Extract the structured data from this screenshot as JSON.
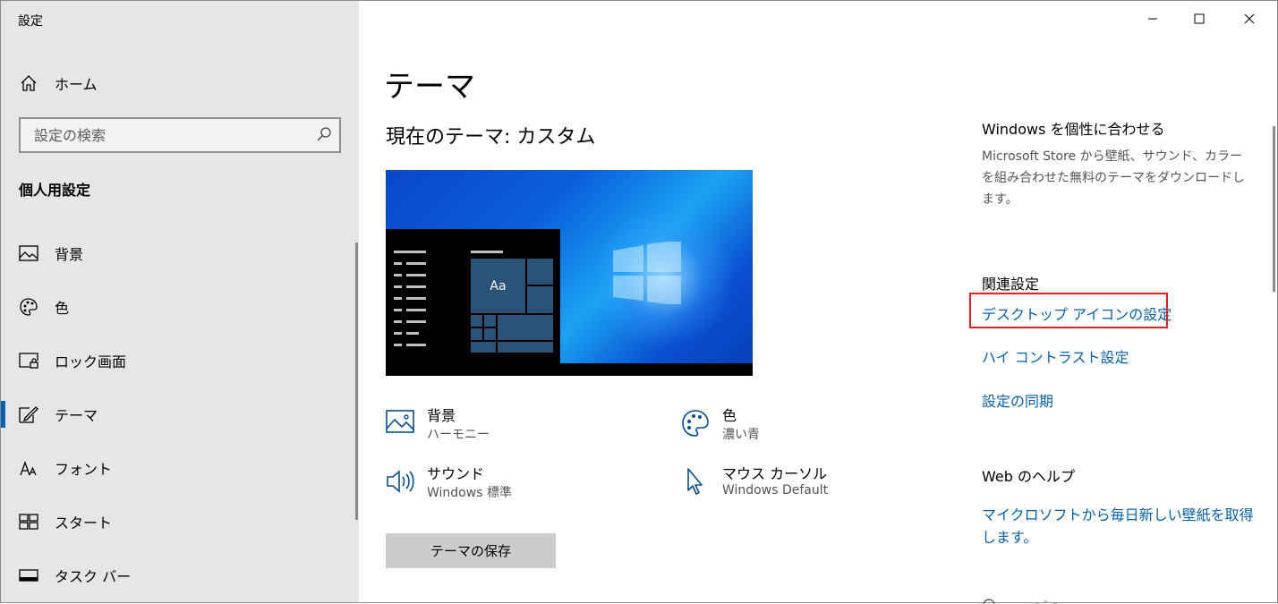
{
  "app": {
    "title": "設定"
  },
  "sidebar": {
    "home_label": "ホーム",
    "search_placeholder": "設定の検索",
    "section_title": "個人用設定",
    "items": [
      {
        "label": "背景",
        "icon": "image-icon"
      },
      {
        "label": "色",
        "icon": "palette-icon"
      },
      {
        "label": "ロック画面",
        "icon": "lock-screen-icon"
      },
      {
        "label": "テーマ",
        "icon": "theme-brush-icon",
        "active": true
      },
      {
        "label": "フォント",
        "icon": "font-icon"
      },
      {
        "label": "スタート",
        "icon": "start-grid-icon"
      },
      {
        "label": "タスク バー",
        "icon": "taskbar-icon"
      }
    ]
  },
  "main": {
    "title": "テーマ",
    "current_theme": "現在のテーマ: カスタム",
    "preview_tile_label": "Aa",
    "properties": [
      {
        "title": "背景",
        "subtitle": "ハーモニー",
        "icon": "image-icon"
      },
      {
        "title": "色",
        "subtitle": "濃い青",
        "icon": "palette-icon"
      },
      {
        "title": "サウンド",
        "subtitle": "Windows 標準",
        "icon": "speaker-icon"
      },
      {
        "title": "マウス カーソル",
        "subtitle": "Windows Default",
        "icon": "cursor-icon"
      }
    ],
    "save_button": "テーマの保存"
  },
  "right_panel": {
    "personalize_heading": "Windows を個性に合わせる",
    "personalize_desc": "Microsoft Store から壁紙、サウンド、カラーを組み合わせた無料のテーマをダウンロードします。",
    "related_heading": "関連設定",
    "links": [
      "デスクトップ アイコンの設定",
      "ハイ コントラスト設定",
      "設定の同期"
    ],
    "help_heading": "Web のヘルプ",
    "help_link": "マイクロソフトから毎日新しい壁紙を取得します。"
  },
  "colors": {
    "accent": "#0063b1",
    "link": "#0a5fa6",
    "highlight": "#e02020",
    "sidebar_bg": "#e6e6e6"
  }
}
